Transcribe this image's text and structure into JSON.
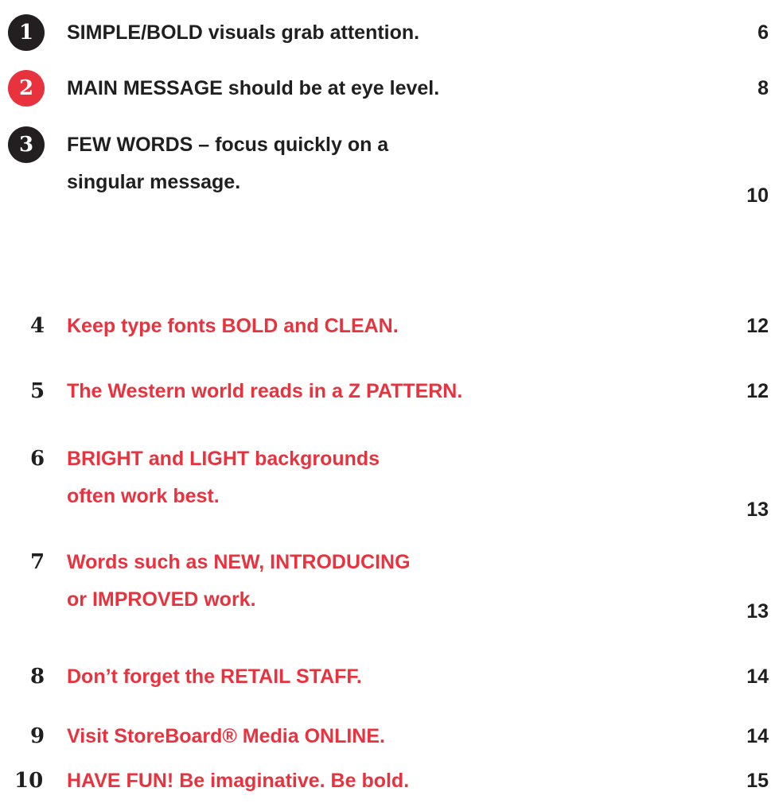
{
  "colors": {
    "text_dark": "#1f1f1f",
    "accent_red": "#e8333f",
    "badge_dark": "#231f20",
    "badge_red": "#e8333f"
  },
  "entries": [
    {
      "number": "1",
      "lines": [
        "SIMPLE/BOLD visuals grab attention."
      ],
      "page": "6"
    },
    {
      "number": "2",
      "lines": [
        "MAIN MESSAGE should be at eye level."
      ],
      "page": "8"
    },
    {
      "number": "3",
      "lines": [
        "FEW WORDS – focus quickly on a",
        "singular message."
      ],
      "page": "10"
    },
    {
      "number": "4",
      "lines": [
        "Keep type fonts BOLD and CLEAN."
      ],
      "page": "12"
    },
    {
      "number": "5",
      "lines": [
        "The Western world reads in a Z PATTERN."
      ],
      "page": "12"
    },
    {
      "number": "6",
      "lines": [
        "BRIGHT and LIGHT backgrounds",
        "often work best."
      ],
      "page": "13"
    },
    {
      "number": "7",
      "lines": [
        "Words such as NEW, INTRODUCING",
        "or IMPROVED work."
      ],
      "page": "13"
    },
    {
      "number": "8",
      "lines": [
        "Don’t forget the RETAIL STAFF."
      ],
      "page": "14"
    },
    {
      "number": "9",
      "lines": [
        "Visit StoreBoard® Media ONLINE."
      ],
      "page": "14"
    },
    {
      "number": "10",
      "lines": [
        "HAVE FUN! Be imaginative. Be bold."
      ],
      "page": "15"
    }
  ]
}
